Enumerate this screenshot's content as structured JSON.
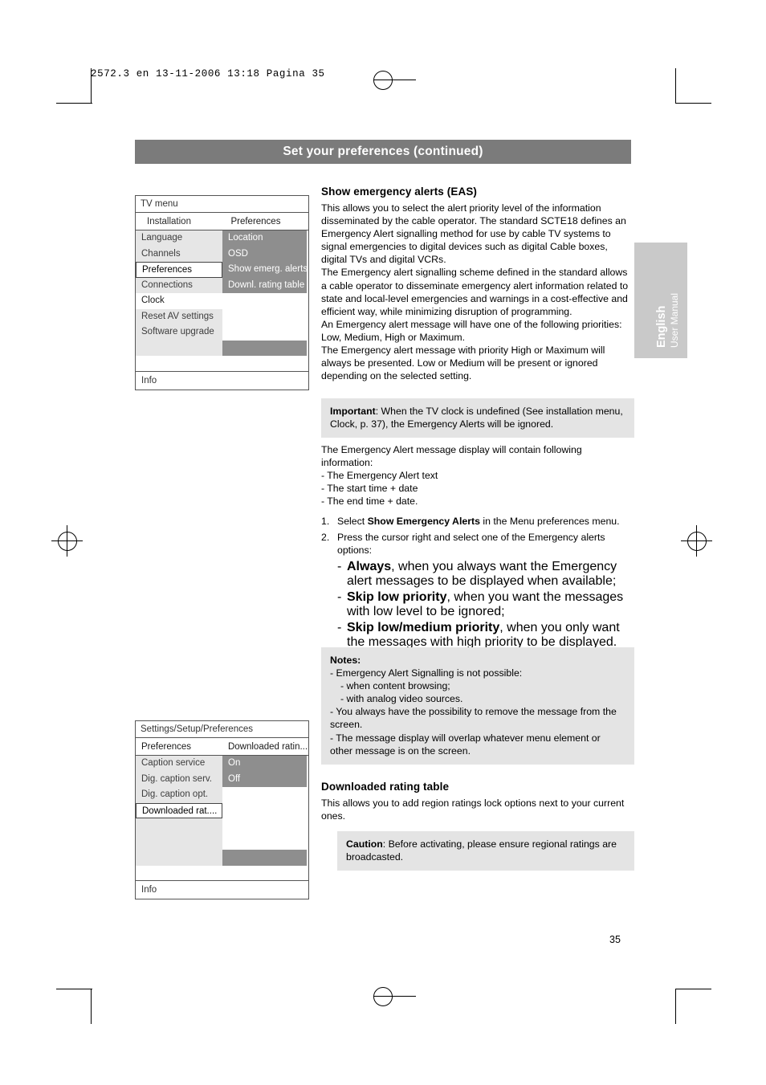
{
  "slug": "2572.3 en   13-11-2006  13:18  Pagina 35",
  "title_bar": "Set your preferences (continued)",
  "side_tab": {
    "language": "English",
    "manual": "User Manual"
  },
  "page_number": "35",
  "tv_menu_top": {
    "header": "TV menu",
    "first_row_left": "Installation",
    "first_row_right": "Preferences",
    "left_items": [
      "Language",
      "Channels",
      "Preferences",
      "Connections",
      "Clock",
      "Reset AV settings",
      "Software upgrade",
      ""
    ],
    "right_items": [
      "Location",
      "OSD",
      "Show emerg. alerts",
      "Downl. rating table",
      "",
      "",
      "",
      ""
    ],
    "info": "Info"
  },
  "tv_menu_bottom": {
    "header": "Settings/Setup/Preferences",
    "first_row_left": "Preferences",
    "first_row_right": "Downloaded ratin...",
    "left_items": [
      "Caption service",
      "Dig. caption serv.",
      "Dig. caption opt.",
      "Downloaded rat....",
      "",
      "",
      ""
    ],
    "right_items": [
      "On",
      "Off",
      "",
      "",
      "",
      "",
      ""
    ],
    "info": "Info"
  },
  "sections": {
    "eas": {
      "heading": "Show emergency alerts (EAS)",
      "p1": "This allows you to select the alert priority level of the information disseminated by the cable operator. The standard SCTE18 defines an Emergency Alert signalling method for use by cable TV systems to signal emergencies to digital devices such as digital Cable boxes, digital TVs and digital VCRs.",
      "p2": "The Emergency alert signalling scheme defined in the standard allows a cable operator to disseminate emergency alert information related to state and local-level emergencies and warnings in a cost-effective and efficient way, while minimizing disruption of programming.",
      "p3": "An Emergency alert message will have one of the following priorities: Low, Medium, High or Maximum.",
      "p4": "The Emergency alert message with priority High or Maximum will always be presented. Low or Medium will be present or ignored depending on the selected setting.",
      "important_label": "Important",
      "important_text": ": When the TV clock is undefined (See installation menu, Clock, p. 37), the Emergency Alerts will be ignored.",
      "p5": "The Emergency Alert message display will contain following information:",
      "bullets": [
        "- The Emergency Alert text",
        "- The start time + date",
        "- The end time + date."
      ],
      "step1_num": "1.",
      "step1_a": "Select ",
      "step1_b": "Show Emergency Alerts",
      "step1_c": " in the Menu preferences menu.",
      "step2_num": "2.",
      "step2_text": "Press the cursor right and select one of the Emergency alerts options:",
      "options": [
        {
          "bold": "Always",
          "rest": ", when you always want the Emergency alert messages to be displayed when available;"
        },
        {
          "bold": "Skip low priority",
          "rest": ", when you want the messages with low level to be ignored;"
        },
        {
          "bold": "Skip low/medium priority",
          "rest": ", when you only want the messages with high priority to be displayed."
        }
      ]
    },
    "notes": {
      "title": "Notes:",
      "items": [
        "- Emergency Alert Signalling is not possible:",
        "- when content browsing;",
        "- with analog video sources.",
        "- You always have the possibility to remove the message from the screen.",
        "- The message display will overlap whatever menu element or other message is on the screen."
      ]
    },
    "drt": {
      "heading": "Downloaded rating table",
      "p1": "This allows you to add region ratings lock options next to your current ones.",
      "caution_label": "Caution",
      "caution_text": ": Before activating, please ensure regional ratings are broadcasted."
    }
  },
  "colors": {
    "title_bar_bg": "#7b7b7b",
    "grey_box_bg": "#e4e4e4",
    "menu_dark": "#8e8e8e",
    "menu_light": "#e6e6e6"
  }
}
